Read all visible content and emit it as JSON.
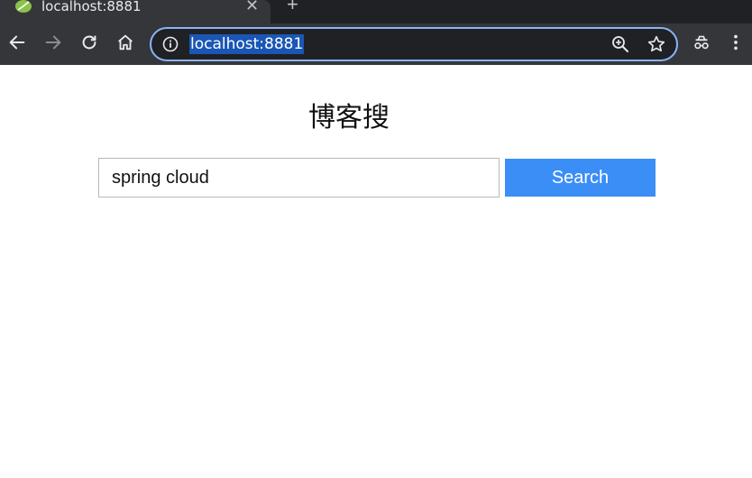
{
  "browser": {
    "tab": {
      "title": "localhost:8881",
      "close_glyph": "✕",
      "favicon": "spring-leaf-icon"
    },
    "new_tab_glyph": "+",
    "omnibox": {
      "url": "localhost:8881"
    },
    "icons": [
      "back-icon",
      "forward-icon",
      "reload-icon",
      "home-icon",
      "info-icon",
      "zoom-icon",
      "star-icon",
      "incognito-icon",
      "menu-icon"
    ]
  },
  "page": {
    "title": "博客搜",
    "search": {
      "value": "spring cloud",
      "button_label": "Search"
    }
  },
  "colors": {
    "chrome_bg": "#35363a",
    "tabstrip_bg": "#202124",
    "omnibox_border": "#8ab4f8",
    "url_highlight": "#1a56b5",
    "button_bg": "#3a8ef6"
  }
}
